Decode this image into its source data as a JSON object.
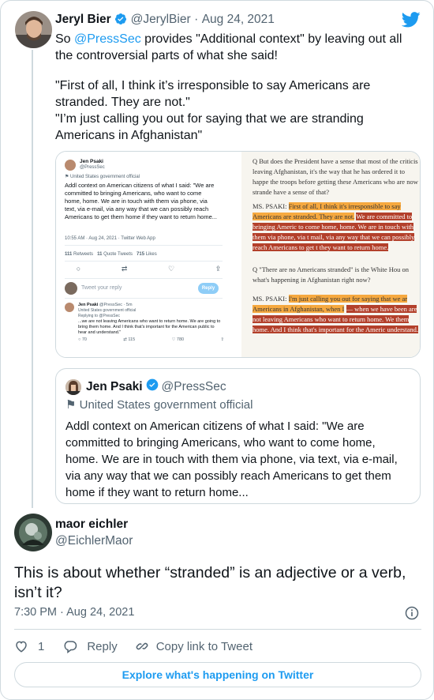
{
  "main_tweet": {
    "author_name": "Jeryl Bier",
    "author_handle": "@JerylBier",
    "separator": "·",
    "date": "Aug 24, 2021",
    "text_prefix": "So ",
    "mention": "@PressSec",
    "text_rest": " provides \"Additional context\" by leaving out all the controversial parts of what she said!",
    "quote_line_1": "\"First of all, I think it’s irresponsible to say Americans are stranded. They are not.\"",
    "quote_line_2": "\"I’m just calling you out for saying that we are stranding Americans in Afghanistan\""
  },
  "media": {
    "left": {
      "name": "Jen Psaki",
      "handle": "@PressSec",
      "affiliation": "United States government official",
      "text": "Addl context on American citizens of what I said: \"We are committed to bringing Americans, who want to come home, home.  We are in touch with them via phone, via text, via e-mail, via any way that we can possibly reach Americans to get them home if they want to return home...",
      "timestamp": "10:55 AM · Aug 24, 2021 · Twitter Web App",
      "retweets": "111",
      "retweets_label": "Retweets",
      "quote_tweets": "11",
      "quote_tweets_label": "Quote Tweets",
      "likes": "715",
      "likes_label": "Likes",
      "reply_placeholder": "Tweet your reply",
      "reply_button": "Reply",
      "reply_name": "Jen Psaki",
      "reply_handle": "@PressSec · 5m",
      "reply_affiliation": "United States government official",
      "replying_to": "Replying to @PressSec",
      "reply_text": "...we are not leaving Americans who want to return home. We are going to bring them home.  And I think that's important for the American public to hear and understand.\"",
      "reply_replies": "70",
      "reply_retweets": "115",
      "reply_likes": "780"
    },
    "right": {
      "q1": "Q    But does the President have a sense that most of the criticis leaving Afghanistan, it's the way that he has ordered it to happe the troops before getting these Americans who are now strande have a sense of that?",
      "answer1_speaker": "MS. PSAKI:",
      "answer1_highlight": "First of all, I think it's irresponsible to say Americans are stranded.  They are not.",
      "answer1_red": "We are committed to bringing Americ to come home, home.  We are in touch with them via phone, via t mail, via any way that we can possibly reach Americans to get t they want to return home.",
      "q2": "Q    \"There are no Americans stranded\" is the White Hou on what's happening in Afghanistan right now?",
      "answer2_speaker": "MS. PSAKI:",
      "answer2_highlight": "I'm just calling you out for saying that we ar Americans in Afghanistan, when I",
      "answer2_red": "— when we have been are not leaving Americans who want to return home.  We them home.  And I think that's important for the Americ understand."
    }
  },
  "quoted_tweet": {
    "author_name": "Jen Psaki",
    "author_handle": "@PressSec",
    "affiliation": "United States government official",
    "text": "Addl context on American citizens of what I said: \"We are committed to bringing Americans, who want to come home, home.  We are in touch with them via phone, via text, via e-mail, via any way that we can possibly reach Americans to get them home if they want to return home..."
  },
  "reply_tweet": {
    "author_name": "maor eichler",
    "author_handle": "@EichlerMaor",
    "text": "This is about whether “stranded” is an adjective or a verb, isn’t it?",
    "time": "7:30 PM",
    "separator": "·",
    "date": "Aug 24, 2021",
    "likes": "1",
    "reply_label": "Reply",
    "copy_link_label": "Copy link to Tweet"
  },
  "footer": {
    "explore_label": "Explore what's happening on Twitter"
  },
  "colors": {
    "twitter_blue": "#1d9bf0",
    "highlight_orange": "#f6a940",
    "highlight_red": "#b3402b"
  },
  "icons": [
    "twitter-logo-icon",
    "verified-badge-icon",
    "flag-icon",
    "info-icon",
    "heart-icon",
    "reply-icon",
    "link-icon"
  ]
}
